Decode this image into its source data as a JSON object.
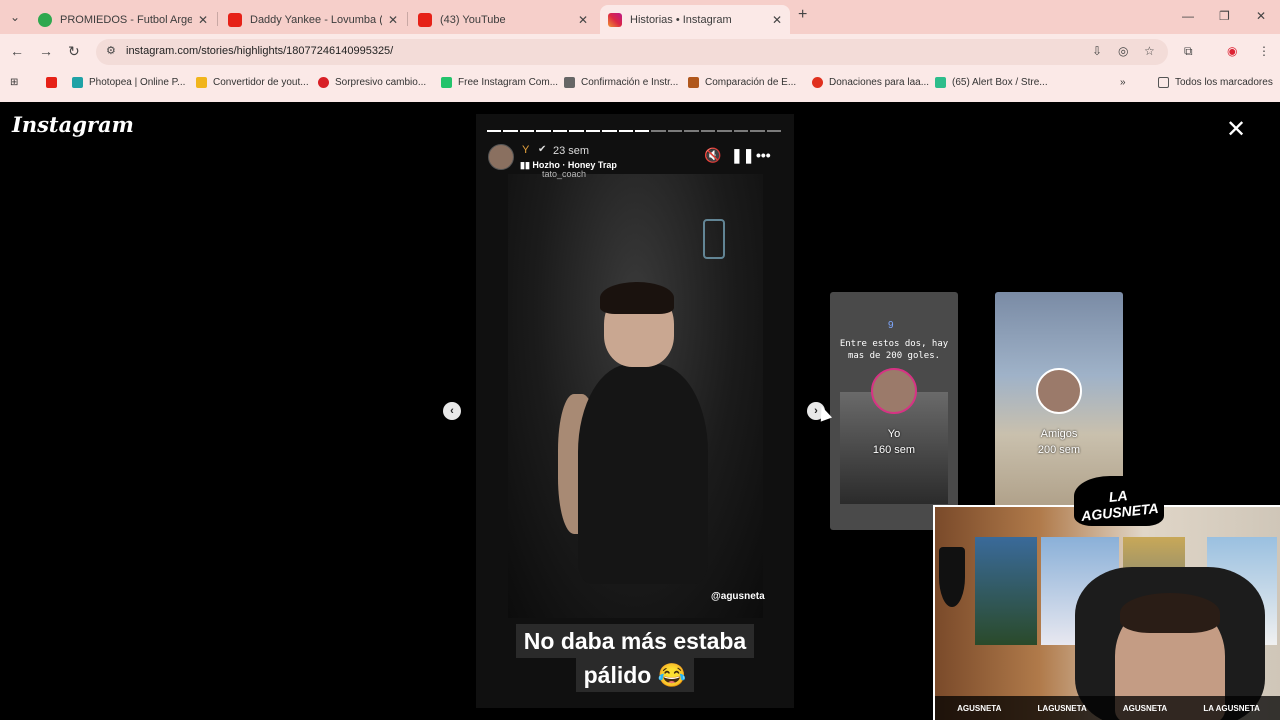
{
  "browser": {
    "tabs": [
      {
        "title": "PROMIEDOS - Futbol Argentino",
        "favicon_color": "#2fa84f"
      },
      {
        "title": "Daddy Yankee - Lovumba (Audio)",
        "favicon_color": "#e62117"
      },
      {
        "title": "(43) YouTube",
        "favicon_color": "#e62117"
      },
      {
        "title": "Historias • Instagram",
        "favicon_color": "#d6249f",
        "active": true
      }
    ],
    "url": "instagram.com/stories/highlights/18077246140995325/",
    "bookmarks": [
      {
        "label": "Photopea | Online P...",
        "color": "#1fa2a6"
      },
      {
        "label": "Convertidor de yout...",
        "color": "#f1b51c"
      },
      {
        "label": "Sorpresivo cambio...",
        "color": "#d81f26"
      },
      {
        "label": "Free Instagram Com...",
        "color": "#23c36b"
      },
      {
        "label": "Confirmación e Instr...",
        "color": "#666666"
      },
      {
        "label": "Comparación de E...",
        "color": "#b0571c"
      },
      {
        "label": "Donaciones para laa...",
        "color": "#e0301e"
      },
      {
        "label": "(65) Alert Box / Stre...",
        "color": "#2dbd8b"
      }
    ],
    "all_bookmarks_label": "Todos los marcadores"
  },
  "instagram": {
    "logo": "Instagram",
    "story": {
      "time_ago": "23 sem",
      "song": "Hozho · Honey Trap",
      "tagged_user": "tato_coach",
      "watermark": "@agusneta",
      "caption_line1": "No daba más estaba",
      "caption_line2": "pálido 😂",
      "progress_segments_total": 18,
      "progress_segments_done": 10
    },
    "next_highlights": [
      {
        "name": "Yo",
        "time": "160 sem",
        "card_text": "Entre estos dos, hay mas de 200 goles.",
        "badge": "9"
      },
      {
        "name": "Amigos",
        "time": "200 sem"
      }
    ]
  },
  "webcam_overlay": {
    "brand": "LA AGUSNETA",
    "socials": [
      "AGUSNETA",
      "LAGUSNETA",
      "AGUSNETA",
      "LA AGUSNETA"
    ]
  }
}
